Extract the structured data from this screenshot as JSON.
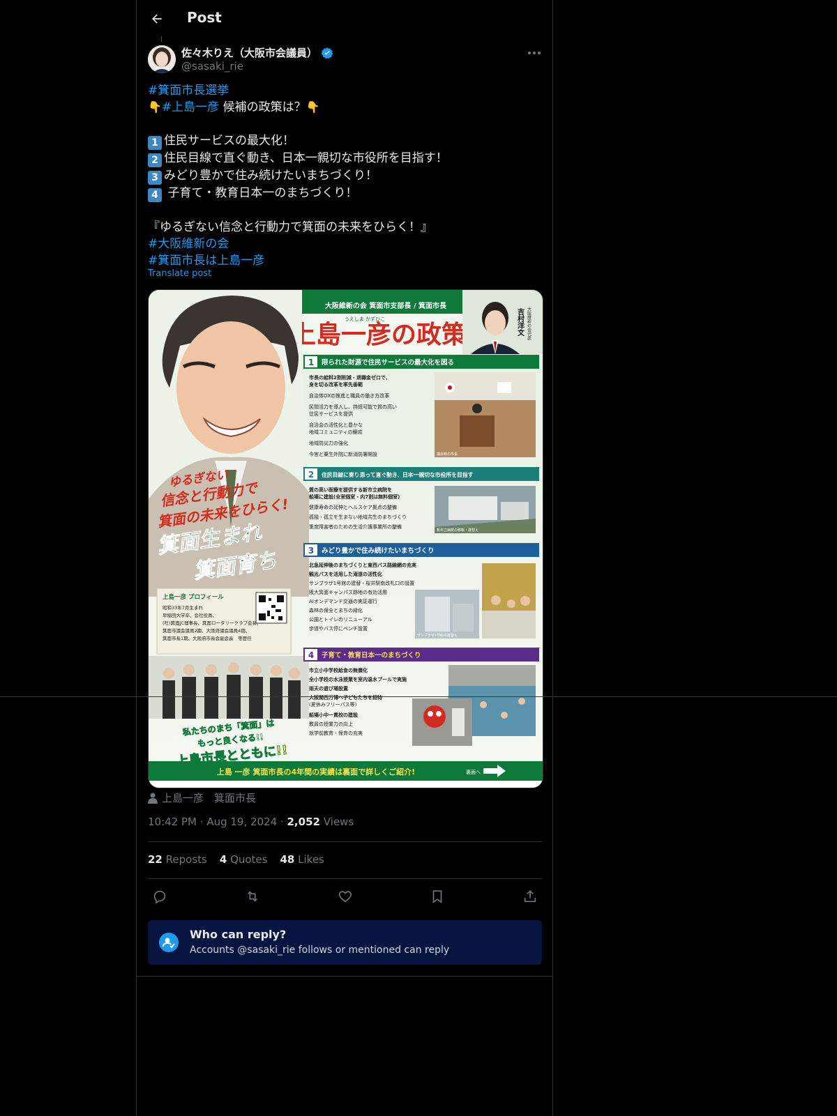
{
  "header": {
    "title": "Post"
  },
  "author": {
    "name": "佐々木りえ（大阪市会議員）",
    "handle": "@sasaki_rie",
    "verified": true
  },
  "tweet": {
    "line1": "#箕面市長選挙",
    "line2_emoji": "👇",
    "line2_tag": "#上島一彦",
    "line2_text": " 候補の政策は？",
    "item1_num": "1",
    "item1_text": "住民サービスの最大化！",
    "item2_num": "2",
    "item2_text": "住民目線で直ぐ動き、日本一親切な市役所を目指す！",
    "item3_num": "3",
    "item3_text": "みどり豊かで住み続けたいまちづくり！",
    "item4_num": "4",
    "item4_text": " 子育て・教育日本一のまちづくり！",
    "slogan": "『ゆるぎない信念と行動力で箕面の未来をひらく！』",
    "tag_a": "#大阪維新の会",
    "tag_b": "#箕面市長は上島一彦"
  },
  "translate_label": "Translate post",
  "media": {
    "org_line": "大阪維新の会 箕面市支部長 / 箕面市長",
    "reading": "うえしま かずひこ",
    "headline": "上島一彦の政策",
    "leader_label": "大阪維新の会代表",
    "leader_name": "吉村洋文",
    "sec1_num": "1",
    "sec1_title": "限られた財源で住民サービスの最大化を図る",
    "sec1_items": [
      "市長の給料2割削減・退職金ゼロで、",
      "身を切る改革を率先垂範",
      "自治体DXの推進と職員の働き方改革",
      "民間活力を導入し、持続可能で質の高い",
      "住民サービスを提供",
      "自治会の活性化と豊かな",
      "地域コミュニティの醸成",
      "地域防災力の強化",
      "今宮と粟生外院に新消防署開設"
    ],
    "sec1_caption": "議会時の市長",
    "sec2_num": "2",
    "sec2_title": "住民目線に寄り添って直ぐ動き、日本一親切な市役所を目指す",
    "sec2_items": [
      "質の高い医療を提供する新市立病院を",
      "船場に建設(全室個室・内7割は無料個室)",
      "健康寿命の延伸とヘルスケア拠点の整備",
      "孤独・孤立を生まない地域共生のまちづくり",
      "重度障害者のための生活介護事業所の整備"
    ],
    "sec2_caption": "新市立病院の移転・建替え",
    "sec3_num": "3",
    "sec3_title": "みどり豊かで住み続けたいまちづくり",
    "sec3_items": [
      "北急延伸後のまちづくりと東西バス路線網の充実",
      "観光バスを活用した滝道の活性化",
      "サンプラザ1号館の建替・桜井駅南改札口の設置",
      "阪大箕面キャンパス跡地の有効活用",
      "AIオンデマンド交通の実証運行",
      "森林の保全とまちの緑化",
      "公園とトイレのリニューアル",
      "歩道やバス停にベンチ設置"
    ],
    "sec3_caption": "サンプラザ1号館の建替え",
    "sec4_num": "4",
    "sec4_title": "子育て・教育日本一のまちづくり",
    "sec4_items": [
      "市立小中学校給食の無償化",
      "全小学校の水泳授業を室内温水プールで実施",
      "雨天の遊び場設置",
      "大阪関西万博へ子どもたちを招待",
      "(夏休みフリーパス等)",
      "船場小中一貫校の建設",
      "教員の授業力の向上",
      "就学前教育・保育の充実"
    ],
    "slogan_lines": [
      "ゆるぎない",
      "信念と行動力で",
      "箕面の未来をひらく!"
    ],
    "born_lines": [
      "箕面生まれ",
      "箕面育ち"
    ],
    "profile_title": "上島一彦 プロフィール",
    "profile_lines": [
      "昭和33年7月生まれ",
      "早稲田大学卒、会社役員、",
      "(社)箕面JC理事長、箕面ロータリークラブ会長、",
      "箕面市議会議員2期、大阪府議会議員4期、",
      "箕面市長1期、大阪府市長会副会長　等歴任"
    ],
    "bottom_lines": [
      "私たちのまち「箕面」は",
      "もっと良くなる!!",
      "上島市長とともに!!"
    ],
    "footer_text": "上島 一彦 箕面市長の4年間の実績は裏面で詳しくご紹介!",
    "footer_small": "裏面へ"
  },
  "alt_label": "上島一彦　箕面市長",
  "meta": {
    "time": "10:42 PM",
    "date": "Aug 19, 2024",
    "views_count": "2,052",
    "views_label": "Views"
  },
  "stats": {
    "reposts_count": "22",
    "reposts_label": "Reposts",
    "quotes_count": "4",
    "quotes_label": "Quotes",
    "likes_count": "48",
    "likes_label": "Likes"
  },
  "reply_box": {
    "title": "Who can reply?",
    "subtitle": "Accounts @sasaki_rie follows or mentioned can reply"
  },
  "icons": [
    "back-arrow-icon",
    "verified-badge-icon",
    "more-icon",
    "person-icon",
    "reply-icon",
    "repost-icon",
    "like-icon",
    "bookmark-icon",
    "share-icon",
    "reply-settings-icon"
  ],
  "colors": {
    "accent": "#1d9bf0",
    "muted": "#71767b",
    "text": "#e7e9ea",
    "reply_box_bg": "#061540",
    "flyer_green": "#0e7a3a",
    "flyer_red": "#d42a1f"
  }
}
